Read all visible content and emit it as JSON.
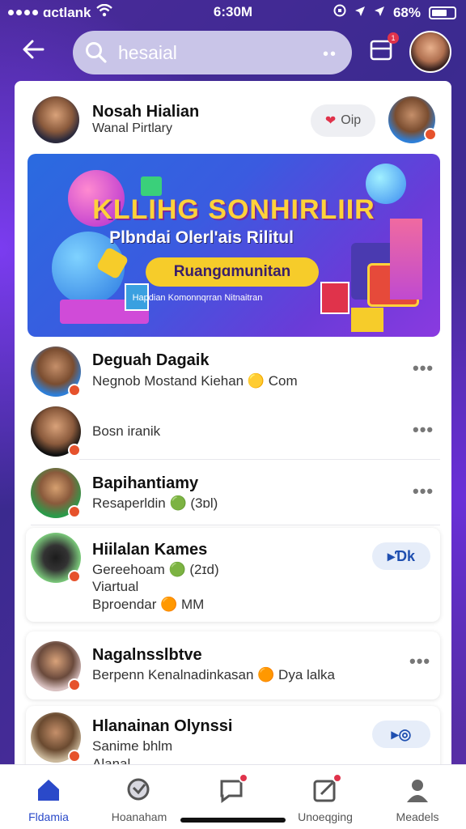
{
  "status_bar": {
    "carrier": "ɑctlank",
    "time": "6:30M",
    "battery": "68%"
  },
  "header": {
    "search_text": "hesaial",
    "search_mic": "••",
    "messages_badge": "1"
  },
  "top_item": {
    "name": "Nosah Hialian",
    "subtitle": "Wanal Pirtlary",
    "action_label": "Oip"
  },
  "banner": {
    "title": "KLLIHG SONHIRLIIR",
    "subtitle": "Plbndai Olerl'ais Rilitul",
    "button": "Ruangɑmunitan",
    "small_text": "Hapdian Komonnqrran Nitnaitran"
  },
  "list": [
    {
      "name": "Deguah Dagaik",
      "line1": "Negnob Mostand Kiehan 🟡 Com",
      "more": "•••"
    },
    {
      "name": "",
      "line1": "Bosn iranik",
      "more": "•••"
    },
    {
      "name": "Bapihantiamy",
      "line1": "Resaperldin 🟢 (3ɒl)",
      "more": "•••"
    }
  ],
  "card1": {
    "name": "Hiilalan Kames",
    "line1": "Gereehoam 🟢 (2ɪd)",
    "line2": "Viartual",
    "line3": "Bproendar 🟠 MM",
    "action": "▸Ɗk"
  },
  "card2": {
    "name": "Nagalnsslbtve",
    "line1": "Berpenn Kenalnadinkasan 🟠 Dya lalka",
    "more": "•••"
  },
  "card3": {
    "name": "Hlanainan Olynssi",
    "line1": "Sanime bhlm",
    "line2": "Alanal",
    "action": "▸◎"
  },
  "nav": [
    {
      "label": "Fldamia",
      "icon": "home-icon",
      "active": true
    },
    {
      "label": "Hoanaham",
      "icon": "explore-icon",
      "active": false
    },
    {
      "label": "",
      "icon": "chat-icon",
      "active": false
    },
    {
      "label": "Unoeqging",
      "icon": "compose-icon",
      "active": false
    },
    {
      "label": "Meadels",
      "icon": "profile-icon",
      "active": false
    }
  ],
  "colors": {
    "accent": "#2a49c9",
    "background": "#4a2a9a",
    "banner_title": "#ffd23a",
    "badge": "#e0334b"
  }
}
